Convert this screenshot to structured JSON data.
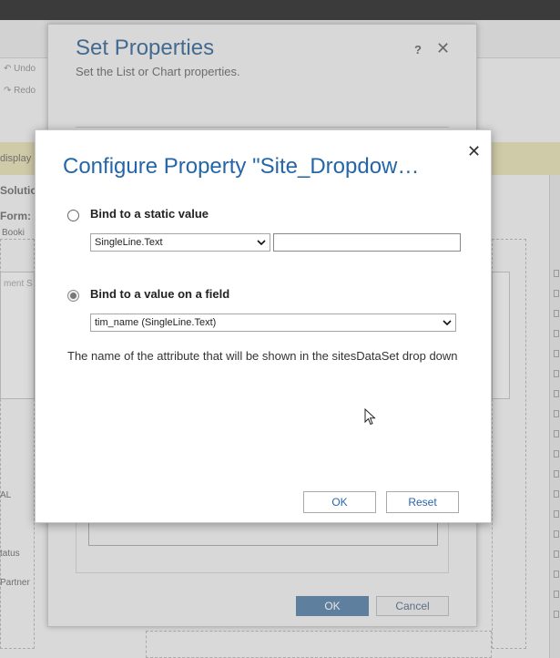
{
  "background": {
    "commands": [
      "Undo",
      "Redo"
    ],
    "notice_fragment": "display",
    "labels": [
      "Solutio",
      "Form:",
      "Booki",
      "ment S",
      "AL",
      "tatus",
      "Partner"
    ]
  },
  "set_properties_dialog": {
    "title": "Set Properties",
    "subtitle": "Set the List or Chart properties.",
    "help_label": "?",
    "close_label": "✕",
    "ok_label": "OK",
    "cancel_label": "Cancel"
  },
  "configure_dialog": {
    "title": "Configure Property \"Site_Dropdow…",
    "close_label": "✕",
    "options": [
      {
        "label": "Bind to a static value",
        "selected": false,
        "type_select_value": "SingleLine.Text",
        "text_value": ""
      },
      {
        "label": "Bind to a value on a field",
        "selected": true,
        "field_select_value": "tim_name (SingleLine.Text)"
      }
    ],
    "description": "The name of the attribute that will be shown in the sitesDataSet drop down",
    "ok_label": "OK",
    "reset_label": "Reset"
  },
  "icons": {
    "dropdown": "chevron-down-icon",
    "close": "close-icon",
    "cursor": "mouse-pointer-icon"
  },
  "colors": {
    "title_blue": "#2566a8",
    "overlay_gray": "#8a8a8a"
  }
}
